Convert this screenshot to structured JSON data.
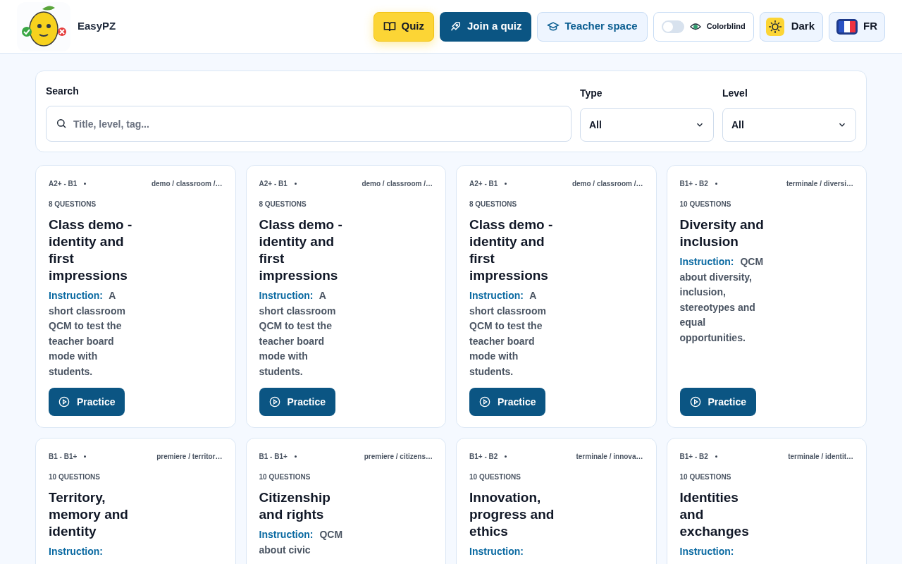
{
  "header": {
    "app_name": "EasyPZ",
    "nav": [
      {
        "kind": "primary",
        "label": "Quiz"
      },
      {
        "kind": "dark",
        "label": "Join a quiz"
      },
      {
        "kind": "light",
        "label": "Teacher space"
      }
    ],
    "colorblind": {
      "label": "Colorblind",
      "on": false
    },
    "theme": {
      "label": "Dark"
    },
    "language": {
      "label": "FR"
    }
  },
  "filters": {
    "search": {
      "label": "Search",
      "placeholder": "Title, level, tag..."
    },
    "type": {
      "label": "Type",
      "value": "All"
    },
    "level": {
      "label": "Level",
      "value": "All"
    }
  },
  "cards": [
    {
      "level": "A2+ - B1",
      "tags": "demo / classroom /…",
      "questions": "8 QUESTIONS",
      "title": "Class demo - identity and first impressions",
      "instruction_label": "Instruction:",
      "instruction": "A short classroom QCM to test the teacher board mode with students.",
      "button": "Practice"
    },
    {
      "level": "A2+ - B1",
      "tags": "demo / classroom /…",
      "questions": "8 QUESTIONS",
      "title": "Class demo - identity and first impressions",
      "instruction_label": "Instruction:",
      "instruction": "A short classroom QCM to test the teacher board mode with students.",
      "button": "Practice"
    },
    {
      "level": "A2+ - B1",
      "tags": "demo / classroom /…",
      "questions": "8 QUESTIONS",
      "title": "Class demo - identity and first impressions",
      "instruction_label": "Instruction:",
      "instruction": "A short classroom QCM to test the teacher board mode with students.",
      "button": "Practice"
    },
    {
      "level": "B1+ - B2",
      "tags": "terminale / diversi…",
      "questions": "10 QUESTIONS",
      "title": "Diversity and inclusion",
      "instruction_label": "Instruction:",
      "instruction": "QCM about diversity, inclusion, stereotypes and equal opportunities.",
      "button": "Practice"
    },
    {
      "level": "B1 - B1+",
      "tags": "premiere / territor…",
      "questions": "10 QUESTIONS",
      "title": "Territory, memory and identity",
      "instruction_label": "Instruction:"
    },
    {
      "level": "B1 - B1+",
      "tags": "premiere / citizens…",
      "questions": "10 QUESTIONS",
      "title": "Citizenship and rights",
      "instruction_label": "Instruction:",
      "instruction": "QCM about civic"
    },
    {
      "level": "B1+ - B2",
      "tags": "terminale / innova…",
      "questions": "10 QUESTIONS",
      "title": "Innovation, progress and ethics",
      "instruction_label": "Instruction:"
    },
    {
      "level": "B1+ - B2",
      "tags": "terminale / identit…",
      "questions": "10 QUESTIONS",
      "title": "Identities and exchanges",
      "instruction_label": "Instruction:"
    }
  ]
}
